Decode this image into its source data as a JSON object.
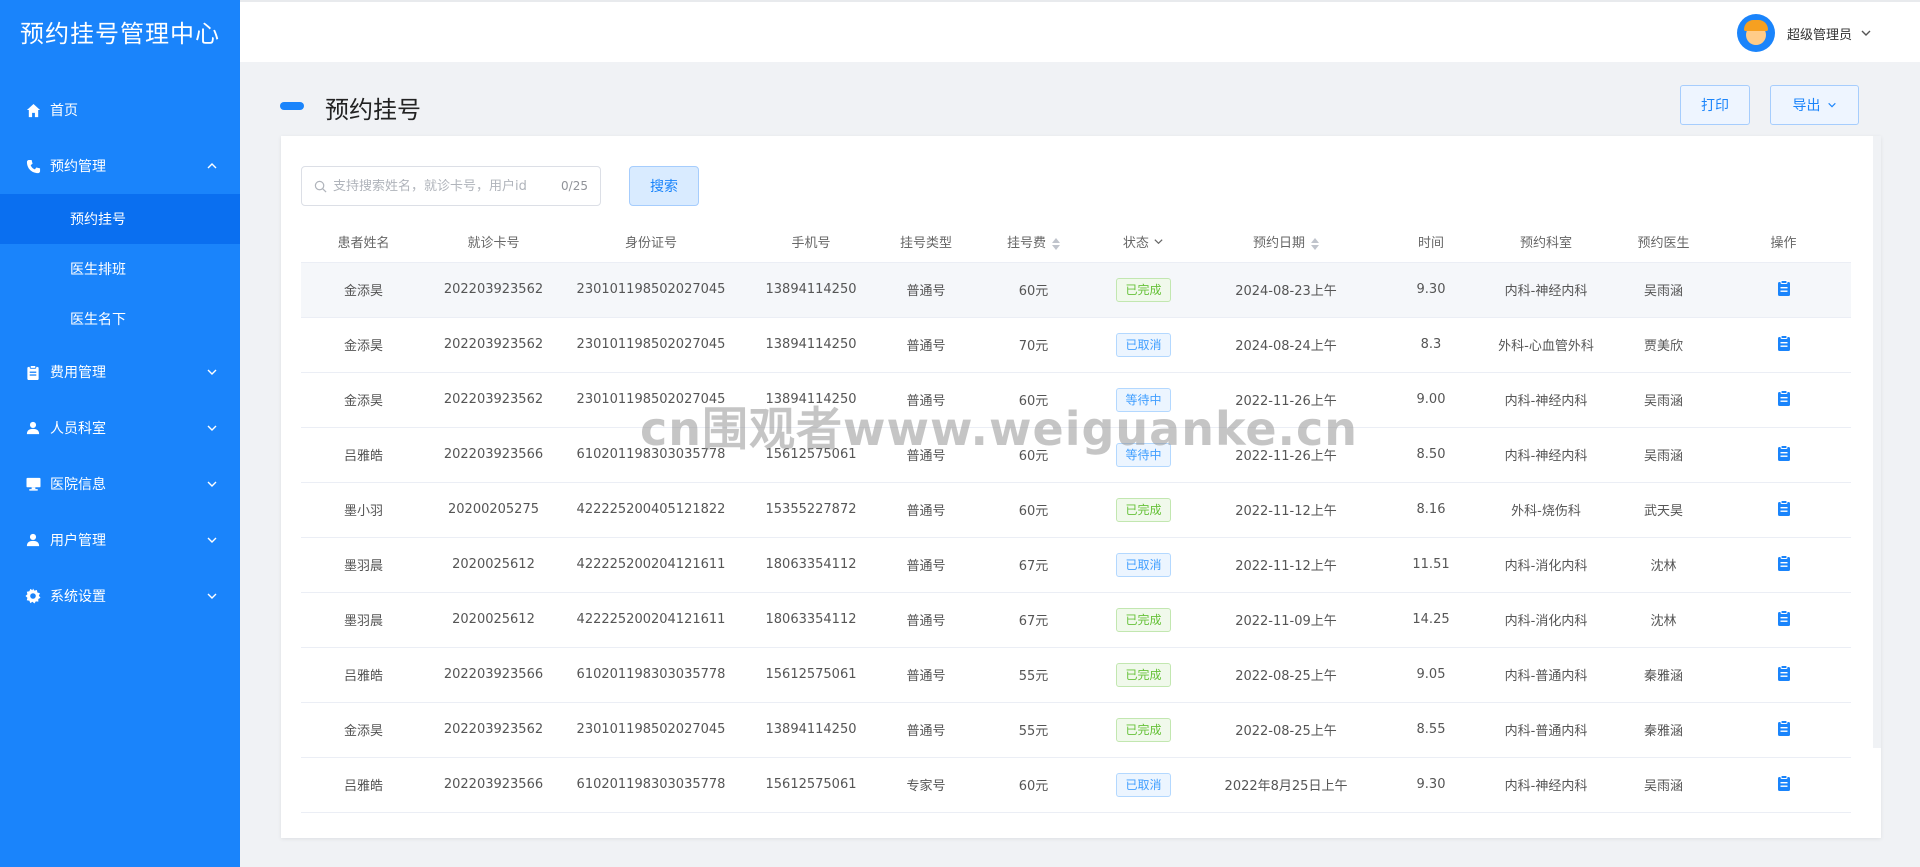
{
  "brand": "预约挂号管理中心",
  "header": {
    "user_name": "超级管理员"
  },
  "sidebar": {
    "items": [
      {
        "label": "首页",
        "icon": "home-icon"
      },
      {
        "label": "预约管理",
        "icon": "phone-icon",
        "sub": [
          "预约挂号",
          "医生排班",
          "医生名下"
        ]
      },
      {
        "label": "费用管理",
        "icon": "clipboard-icon"
      },
      {
        "label": "人员科室",
        "icon": "user-icon"
      },
      {
        "label": "医院信息",
        "icon": "monitor-icon"
      },
      {
        "label": "用户管理",
        "icon": "user-icon"
      },
      {
        "label": "系统设置",
        "icon": "gear-icon"
      }
    ]
  },
  "page": {
    "title": "预约挂号",
    "print_label": "打印",
    "export_label": "导出"
  },
  "search": {
    "placeholder": "支持搜索姓名，就诊卡号，用户id",
    "count": "0/25",
    "button": "搜索"
  },
  "table": {
    "columns": [
      "患者姓名",
      "就诊卡号",
      "身份证号",
      "手机号",
      "挂号类型",
      "挂号费",
      "状态",
      "预约日期",
      "时间",
      "预约科室",
      "预约医生",
      "操作"
    ],
    "rows": [
      [
        "金添昊",
        "202203923562",
        "230101198502027045",
        "13894114250",
        "普通号",
        "60元",
        "已完成",
        "2024-08-23上午",
        "9.30",
        "内科-神经内科",
        "吴雨涵"
      ],
      [
        "金添昊",
        "202203923562",
        "230101198502027045",
        "13894114250",
        "普通号",
        "70元",
        "已取消",
        "2024-08-24上午",
        "8.3",
        "外科-心血管外科",
        "贾美欣"
      ],
      [
        "金添昊",
        "202203923562",
        "230101198502027045",
        "13894114250",
        "普通号",
        "60元",
        "等待中",
        "2022-11-26上午",
        "9.00",
        "内科-神经内科",
        "吴雨涵"
      ],
      [
        "吕雅皓",
        "202203923566",
        "610201198303035778",
        "15612575061",
        "普通号",
        "60元",
        "等待中",
        "2022-11-26上午",
        "8.50",
        "内科-神经内科",
        "吴雨涵"
      ],
      [
        "墨小羽",
        "20200205275",
        "422225200405121822",
        "15355227872",
        "普通号",
        "60元",
        "已完成",
        "2022-11-12上午",
        "8.16",
        "外科-烧伤科",
        "武天昊"
      ],
      [
        "墨羽晨",
        "2020025612",
        "422225200204121611",
        "18063354112",
        "普通号",
        "67元",
        "已取消",
        "2022-11-12上午",
        "11.51",
        "内科-消化内科",
        "沈林"
      ],
      [
        "墨羽晨",
        "2020025612",
        "422225200204121611",
        "18063354112",
        "普通号",
        "67元",
        "已完成",
        "2022-11-09上午",
        "14.25",
        "内科-消化内科",
        "沈林"
      ],
      [
        "吕雅皓",
        "202203923566",
        "610201198303035778",
        "15612575061",
        "普通号",
        "55元",
        "已完成",
        "2022-08-25上午",
        "9.05",
        "内科-普通内科",
        "秦雅涵"
      ],
      [
        "金添昊",
        "202203923562",
        "230101198502027045",
        "13894114250",
        "普通号",
        "55元",
        "已完成",
        "2022-08-25上午",
        "8.55",
        "内科-普通内科",
        "秦雅涵"
      ],
      [
        "吕雅皓",
        "202203923566",
        "610201198303035778",
        "15612575061",
        "专家号",
        "60元",
        "已取消",
        "2022年8月25日上午",
        "9.30",
        "内科-神经内科",
        "吴雨涵"
      ]
    ]
  },
  "status_colors": {
    "已完成": "green",
    "已取消": "blue",
    "等待中": "blue"
  },
  "watermark": "cn围观者www.weiguanke.cn"
}
